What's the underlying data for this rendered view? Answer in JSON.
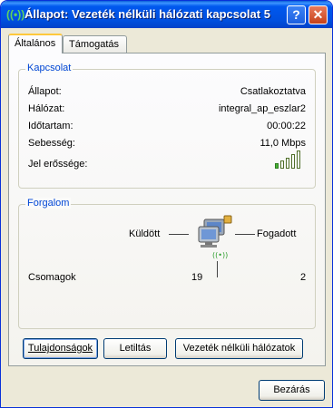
{
  "window": {
    "title": "Állapot: Vezeték nélküli hálózati kapcsolat 5",
    "help_glyph": "?",
    "close_glyph": "✕"
  },
  "tabs": [
    {
      "label": "Általános",
      "active": true
    },
    {
      "label": "Támogatás",
      "active": false
    }
  ],
  "connection": {
    "legend": "Kapcsolat",
    "rows": [
      {
        "label": "Állapot:",
        "value": "Csatlakoztatva"
      },
      {
        "label": "Hálózat:",
        "value": "integral_ap_eszlar2"
      },
      {
        "label": "Időtartam:",
        "value": "00:00:22"
      },
      {
        "label": "Sebesség:",
        "value": "11,0 Mbps"
      },
      {
        "label": "Jel erőssége:",
        "value": ""
      }
    ],
    "signal_bars_lit": 1,
    "signal_bars_total": 5
  },
  "activity": {
    "legend": "Forgalom",
    "sent_label": "Küldött",
    "received_label": "Fogadott",
    "packets_label": "Csomagok",
    "packets_sent": "19",
    "packets_received": "2",
    "separator": "|"
  },
  "buttons": {
    "properties": "Tulajdonságok",
    "disable": "Letiltás",
    "wireless_networks": "Vezeték nélküli hálózatok",
    "close": "Bezárás"
  },
  "colors": {
    "titlebar": "#0050e0",
    "legend_text": "#0046d5",
    "signal_on": "#49b136"
  }
}
